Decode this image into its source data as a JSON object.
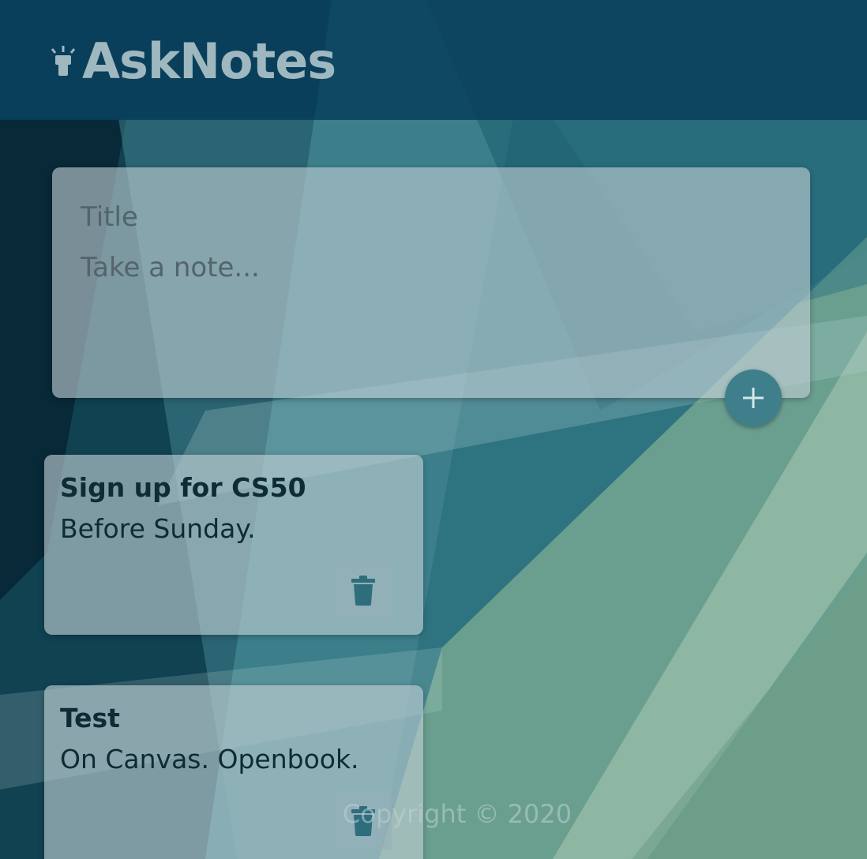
{
  "header": {
    "app_title": "AskNotes",
    "logo_icon": "lightbulb-icon"
  },
  "composer": {
    "title_placeholder": "Title",
    "content_placeholder": "Take a note...",
    "add_icon": "plus-icon"
  },
  "notes": [
    {
      "title": "Sign up for CS50",
      "content": "Before Sunday.",
      "delete_icon": "trash-icon"
    },
    {
      "title": "Test",
      "content": "On Canvas. Openbook.",
      "delete_icon": "trash-icon"
    }
  ],
  "footer": {
    "text": "Copyright © 2020"
  },
  "colors": {
    "header_bg": "#083e5c",
    "accent": "#3f7f8c",
    "note_text": "#0f2b33"
  }
}
